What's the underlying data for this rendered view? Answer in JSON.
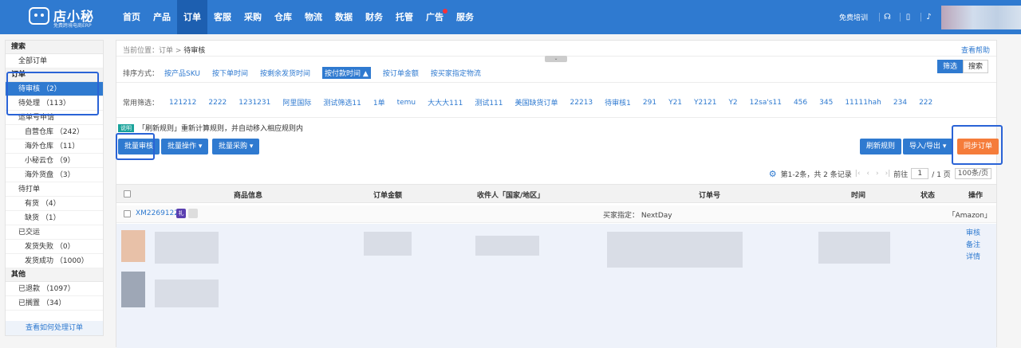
{
  "header": {
    "logo_name": "店小秘",
    "logo_sub": "免费跨境电商ERP",
    "nav": [
      "首页",
      "产品",
      "订单",
      "客服",
      "采购",
      "仓库",
      "物流",
      "数据",
      "财务",
      "托管",
      "广告",
      "服务"
    ],
    "active_nav": "订单",
    "free_training": "免费培训",
    "icons": [
      "headset-icon",
      "book-icon",
      "bell-icon"
    ]
  },
  "sidebar": {
    "search_title": "搜索",
    "all_orders": "全部订单",
    "order_title": "订单",
    "pending_review": "待审核 （2）",
    "pending_process": "待处理 （113）",
    "waybill": "运单号申请",
    "own_wh": "自营仓库 （242）",
    "overseas_wh": "海外仓库 （11）",
    "xm_cloud": "小秘云仓 （9）",
    "overseas_goods": "海外货盘 （3）",
    "to_print": "待打单",
    "in_stock": "有货 （4）",
    "out_stock": "缺货 （1）",
    "shipped": "已交运",
    "ship_fail": "发货失败 （0）",
    "ship_ok": "发货成功 （1000）",
    "other_title": "其他",
    "refunded": "已退款 （1097）",
    "shelved": "已搁置 （34）",
    "help_link": "查看如何处理订单"
  },
  "main": {
    "crumb_prefix": "当前位置：",
    "crumb_1": "订单",
    "crumb_sep": " > ",
    "crumb_2": "待审核",
    "view_help": "查看帮助",
    "sort_label": "排序方式：",
    "sort_options": [
      "按产品SKU",
      "按下单时间",
      "按剩余发货时间",
      "按付款时间 ▲",
      "按订单金额",
      "按买家指定物流"
    ],
    "filter_btn": "筛选",
    "search_btn": "搜索",
    "common_label": "常用筛选：",
    "common_filters": [
      "121212",
      "2222",
      "1231231",
      "阿里国际",
      "测试筛选11",
      "1单",
      "temu",
      "大大大111",
      "测试111",
      "美国缺货订单",
      "22213",
      "待审核1",
      "291",
      "Y21",
      "Y2121",
      "Y2",
      "12sa's11",
      "456",
      "345",
      "11111hah",
      "234",
      "222"
    ],
    "note_tag": "说明",
    "note_text": "「刷新规则」重新计算规则，并自动移入相应规则内",
    "btn_batch_review": "批量审核",
    "btn_batch_ops": "批量操作 ▾",
    "btn_batch_purchase": "批量采购 ▾",
    "btn_refresh_rule": "刷新规则",
    "btn_import_export": "导入/导出 ▾",
    "btn_sync": "同步订单",
    "pager_info": "第1-2条，共 2 条记录",
    "pager_goto": "前往",
    "pager_page": "1",
    "pager_total": "/ 1 页",
    "pager_size": "100条/页",
    "cols": [
      "商品信息",
      "订单金额",
      "收件人「国家/地区」",
      "订单号",
      "时间",
      "状态",
      "操作"
    ],
    "order_no": "XM2269122",
    "gift": "礼",
    "buyer": "买家指定：  NextDay",
    "shop": "「Amazon」",
    "actions": [
      "审核",
      "备注",
      "详情"
    ]
  }
}
